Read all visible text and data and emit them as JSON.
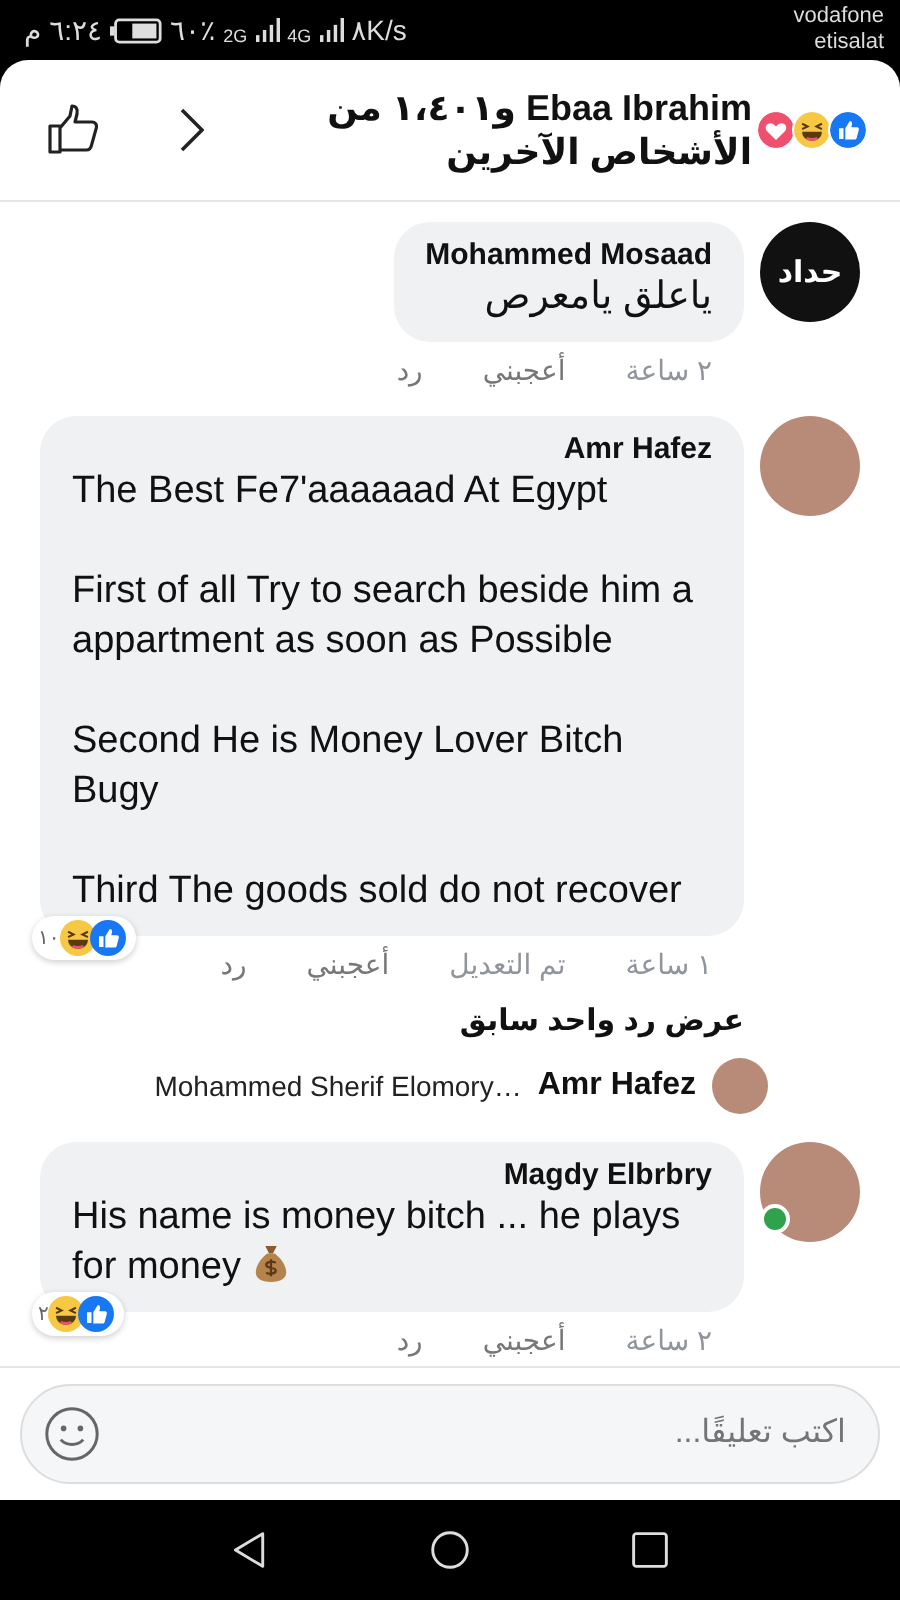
{
  "status_bar": {
    "time": "٦:٢٤ م",
    "battery": "٦٠٪",
    "network_1": "2G",
    "network_2": "4G",
    "speed": "٨K/s",
    "carrier_1": "vodafone",
    "carrier_2": "etisalat"
  },
  "header": {
    "reactions": [
      {
        "kind": "like"
      },
      {
        "kind": "haha"
      },
      {
        "kind": "love"
      }
    ],
    "title": "Ebaa Ibrahim و١،٤٠١ من الأشخاص الآخرين"
  },
  "comments": [
    {
      "author": "Mohammed Mosaad",
      "avatar": {
        "kind": "logo",
        "text": "حداد"
      },
      "online": false,
      "text": "ياعلق يامعرص",
      "money_icon": false,
      "time": "٢ ساعة",
      "like": "أعجبني",
      "reply": "رد"
    },
    {
      "author": "Amr Hafez",
      "avatar": {
        "kind": "photo"
      },
      "online": false,
      "text": "The Best Fe7'aaaaaad At Egypt\n\nFirst of all Try to search beside him a appartment as soon as Possible\n\nSecond He is Money Lover Bitch Bugy\n\nThird The goods sold do not recover",
      "money_icon": false,
      "time": "١ ساعة",
      "edited_label": "تم التعديل",
      "like": "أعجبني",
      "reply": "رد",
      "reactions": {
        "kinds": [
          {
            "kind": "like"
          },
          {
            "kind": "haha"
          }
        ],
        "count": "١٠"
      },
      "previous_replies": "عرض رد واحد سابق",
      "reply_preview": {
        "author": "Amr Hafez",
        "text": "Mohammed Sherif Elomory…"
      }
    },
    {
      "author": "Magdy Elbrbry",
      "avatar": {
        "kind": "photo"
      },
      "online": true,
      "text": "His name is money bitch ... he plays for money",
      "money_icon": true,
      "time": "٢ ساعة",
      "like": "أعجبني",
      "reply": "رد",
      "reactions": {
        "kinds": [
          {
            "kind": "like"
          },
          {
            "kind": "haha"
          }
        ],
        "count": "٢"
      }
    }
  ],
  "composer": {
    "placeholder": "اكتب تعليقًا..."
  }
}
